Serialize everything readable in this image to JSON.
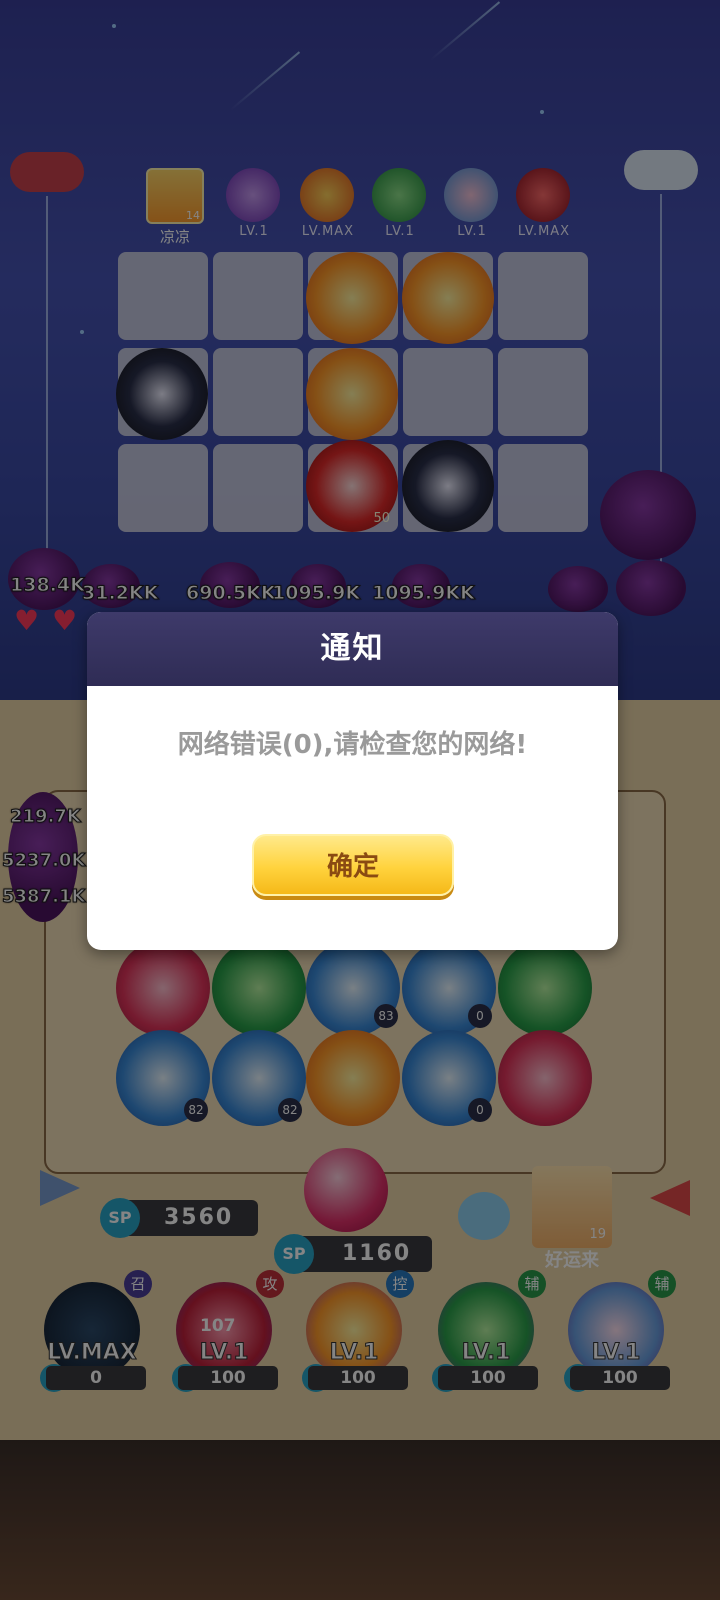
{
  "player": {
    "name": "凉凉",
    "level": "14"
  },
  "pets": [
    {
      "icon": "purple-flower-orb-icon",
      "level": "LV.1"
    },
    {
      "icon": "gold-star-orb-icon",
      "level": "LV.MAX"
    },
    {
      "icon": "green-arrow-orb-icon",
      "level": "LV.1"
    },
    {
      "icon": "rainbow-figure-orb-icon",
      "level": "LV.1"
    },
    {
      "icon": "red-venom-orb-icon",
      "level": "LV.MAX"
    }
  ],
  "upper_field": {
    "tile_badge": "50",
    "damage_numbers": [
      "138.4K",
      "31.2KK",
      "690.5KK",
      "1095.9K",
      "1095.9KK"
    ]
  },
  "left_stack": [
    "219.7K",
    "5237.0K",
    "5387.1K"
  ],
  "lower_grid": {
    "counts": [
      "83",
      "0",
      "82",
      "82",
      "0"
    ]
  },
  "sp": {
    "label": "SP",
    "main_value": "3560",
    "center_value": "1160"
  },
  "lucky": {
    "label": "好运来",
    "level": "19"
  },
  "heroes": [
    {
      "level": "LV.MAX",
      "tag": "召",
      "sp": "0",
      "extra": ""
    },
    {
      "level": "LV.1",
      "tag": "攻",
      "sp": "100",
      "extra": "107"
    },
    {
      "level": "LV.1",
      "tag": "控",
      "sp": "100",
      "extra": ""
    },
    {
      "level": "LV.1",
      "tag": "辅",
      "sp": "100",
      "extra": ""
    },
    {
      "level": "LV.1",
      "tag": "辅",
      "sp": "100",
      "extra": ""
    }
  ],
  "dialog": {
    "title": "通知",
    "message": "网络错误(0),请检查您的网络!",
    "confirm_label": "确定"
  },
  "colors": {
    "accent": "#ffd33d",
    "dialog_header": "#3e3a6a",
    "overlay": "rgba(0,0,0,0.48)"
  }
}
